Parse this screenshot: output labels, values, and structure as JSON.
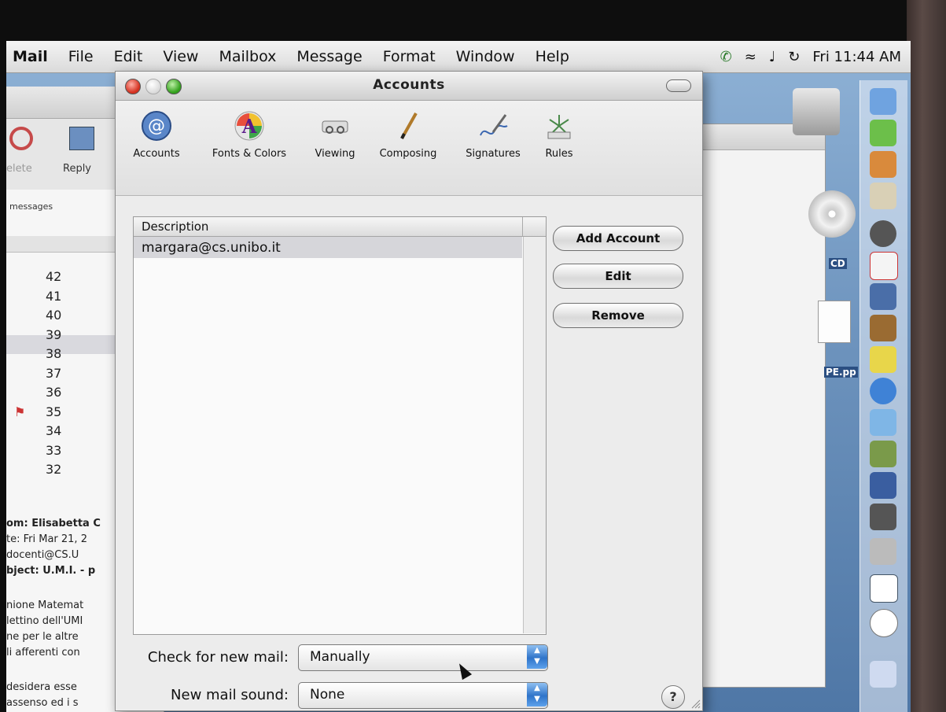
{
  "menubar": {
    "app": "Mail",
    "items": [
      "File",
      "Edit",
      "View",
      "Mailbox",
      "Message",
      "Format",
      "Window",
      "Help"
    ],
    "clock": "Fri 11:44 AM"
  },
  "background_mail": {
    "toolbar": {
      "delete_label": "elete",
      "reply_label": "Reply"
    },
    "messages_label": "messages",
    "message_numbers": [
      "42",
      "41",
      "40",
      "39",
      "38",
      "37",
      "36",
      "35",
      "34",
      "33",
      "32"
    ],
    "preview_lines": [
      "om: Elisabetta C",
      "te: Fri Mar 21, 2",
      " docenti@CS.U",
      "bject: U.M.I. - p",
      "",
      "nione Matemat",
      "lettino dell'UMI",
      "ne per le altre",
      "li afferenti con",
      "",
      " desidera esse",
      " assenso ed i s"
    ]
  },
  "desktop": {
    "cd_label": "CD",
    "doc_label": "PE.pp"
  },
  "accounts_window": {
    "title": "Accounts",
    "toolbar": [
      {
        "label": "Accounts",
        "icon": "at-sign-icon"
      },
      {
        "label": "Fonts & Colors",
        "icon": "font-icon"
      },
      {
        "label": "Viewing",
        "icon": "glasses-icon"
      },
      {
        "label": "Composing",
        "icon": "pen-icon"
      },
      {
        "label": "Signatures",
        "icon": "signature-icon"
      },
      {
        "label": "Rules",
        "icon": "rules-icon"
      }
    ],
    "list": {
      "header": "Description",
      "rows": [
        "margara@cs.unibo.it"
      ]
    },
    "buttons": {
      "add": "Add Account",
      "edit": "Edit",
      "remove": "Remove"
    },
    "check_mail": {
      "label": "Check for new mail:",
      "value": "Manually"
    },
    "new_mail_sound": {
      "label": "New mail sound:",
      "value": "None"
    },
    "help": "?"
  }
}
